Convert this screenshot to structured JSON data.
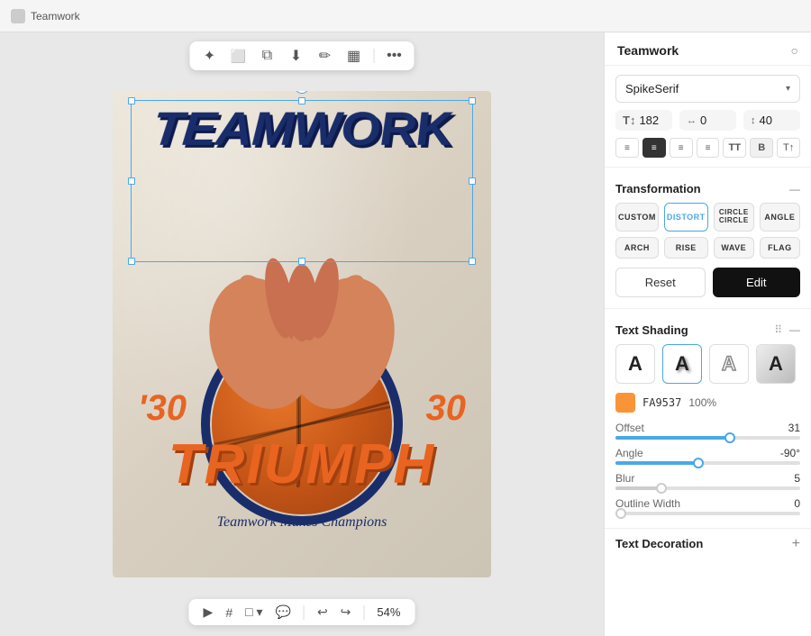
{
  "app": {
    "title": "Teamwork"
  },
  "toolbar_top": {
    "tools": [
      "sparkle",
      "frame",
      "copy",
      "download",
      "brush",
      "image",
      "more"
    ]
  },
  "toolbar_bottom": {
    "tools": [
      "play",
      "grid",
      "rect",
      "chat"
    ],
    "undo_label": "↩",
    "redo_label": "↪",
    "zoom_label": "54%"
  },
  "right_panel": {
    "title": "Teamwork",
    "font": {
      "name": "SpikeSerif",
      "size": "182",
      "letter_spacing": "0",
      "line_height": "40"
    },
    "transformation": {
      "title": "Transformation",
      "buttons": [
        "CUSTOM",
        "DISTORT",
        "CIRCLE\nCIRCLE",
        "ANGLE",
        "ARCH",
        "RISE",
        "WAVE",
        "FLAG"
      ],
      "active": "DISTORT",
      "reset_label": "Reset",
      "edit_label": "Edit"
    },
    "text_shading": {
      "title": "Text Shading",
      "types": [
        "A",
        "A",
        "A",
        "A"
      ],
      "active_index": 1,
      "color_hex": "FA9537",
      "color_opacity": "100%",
      "offset_label": "Offset",
      "offset_value": "31",
      "offset_percent": 62,
      "angle_label": "Angle",
      "angle_value": "-90°",
      "angle_percent": 45,
      "blur_label": "Blur",
      "blur_value": "5",
      "blur_percent": 25,
      "outline_label": "Outline Width",
      "outline_value": "0",
      "outline_percent": 0
    },
    "text_decoration": {
      "title": "Text Decoration"
    }
  },
  "canvas": {
    "teamwork_text": "TEAMWORK",
    "score_left": "'30",
    "score_right": "30",
    "triumph_text": "TRIUMPH",
    "tagline": "Teamwork Makes Champions"
  }
}
